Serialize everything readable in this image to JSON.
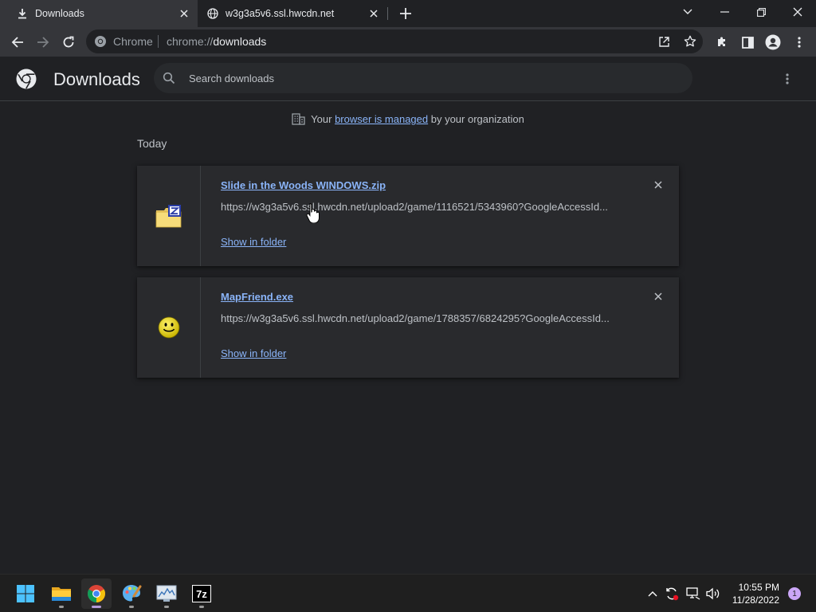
{
  "tabs": [
    {
      "label": "Downloads",
      "icon": "download-icon"
    },
    {
      "label": "w3g3a5v6.ssl.hwcdn.net",
      "icon": "globe-icon"
    }
  ],
  "omnibox": {
    "scheme_label": "Chrome",
    "url_prefix": "chrome://",
    "url_path": "downloads"
  },
  "page": {
    "title": "Downloads",
    "search_placeholder": "Search downloads",
    "managed": {
      "before": "Your ",
      "link": "browser is managed",
      "after": " by your organization"
    },
    "date_group": "Today"
  },
  "downloads": [
    {
      "filename": "Slide in the Woods WINDOWS.zip",
      "url": "https://w3g3a5v6.ssl.hwcdn.net/upload2/game/1116521/5343960?GoogleAccessId...",
      "action": "Show in folder",
      "icon": "zip-folder-icon"
    },
    {
      "filename": "MapFriend.exe",
      "url": "https://w3g3a5v6.ssl.hwcdn.net/upload2/game/1788357/6824295?GoogleAccessId...",
      "action": "Show in folder",
      "icon": "smiley-exe-icon"
    }
  ],
  "taskbar": {
    "apps": [
      "start-icon",
      "file-explorer-icon",
      "chrome-icon",
      "paint-icon",
      "monitor-app-icon",
      "7zip-icon"
    ],
    "time": "10:55 PM",
    "date": "11/28/2022",
    "notifications": "1"
  },
  "colors": {
    "link": "#8ab4f8",
    "background": "#202124",
    "card": "#292a2d",
    "toolbar": "#35363a"
  }
}
